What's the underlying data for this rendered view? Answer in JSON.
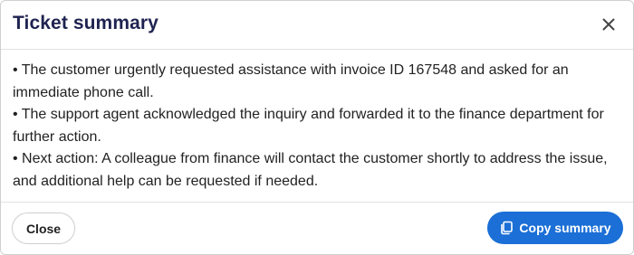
{
  "dialog": {
    "title": "Ticket summary",
    "close_icon": "close-icon",
    "summary_lines": [
      "• The customer urgently requested assistance with invoice ID 167548 and asked for an immediate phone call.",
      "• The support agent acknowledged the inquiry and forwarded it to the finance department for further action.",
      "• Next action: A colleague from finance will contact the customer shortly to address the issue, and additional help can be requested if needed."
    ],
    "close_label": "Close",
    "copy_label": "Copy summary",
    "copy_icon": "copy-icon"
  },
  "colors": {
    "title": "#1f2350",
    "primary": "#1b6fd6"
  }
}
